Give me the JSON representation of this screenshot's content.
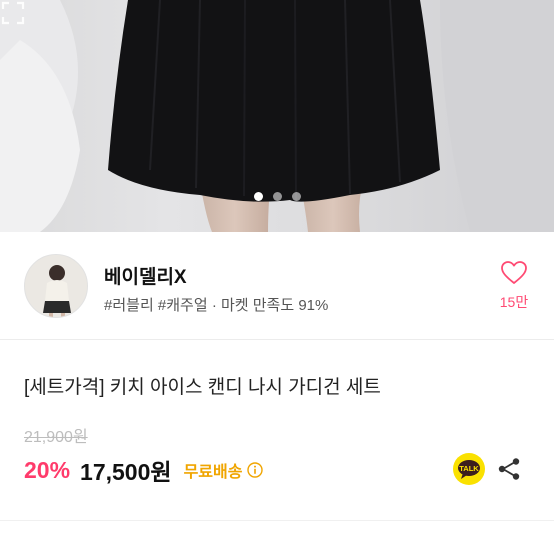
{
  "gallery": {
    "image_alt": "product-photo-black-pleated-skirt",
    "page_indicator": {
      "total": 3,
      "current": 1
    }
  },
  "seller": {
    "name": "베이델리X",
    "tags": "#러블리 #캐주얼 · 마켓 만족도 91%",
    "likes": "15만"
  },
  "product": {
    "title": "[세트가격] 키치 아이스 캔디 나시 가디건 세트",
    "original_price": "21,900원",
    "discount": "20%",
    "price": "17,500원",
    "shipping": "무료배송"
  },
  "actions": {
    "talk_label": "TALK"
  },
  "colors": {
    "accent_pink": "#ff3b6b",
    "shipping_yellow": "#f0a500",
    "kakao_yellow": "#fae100"
  }
}
